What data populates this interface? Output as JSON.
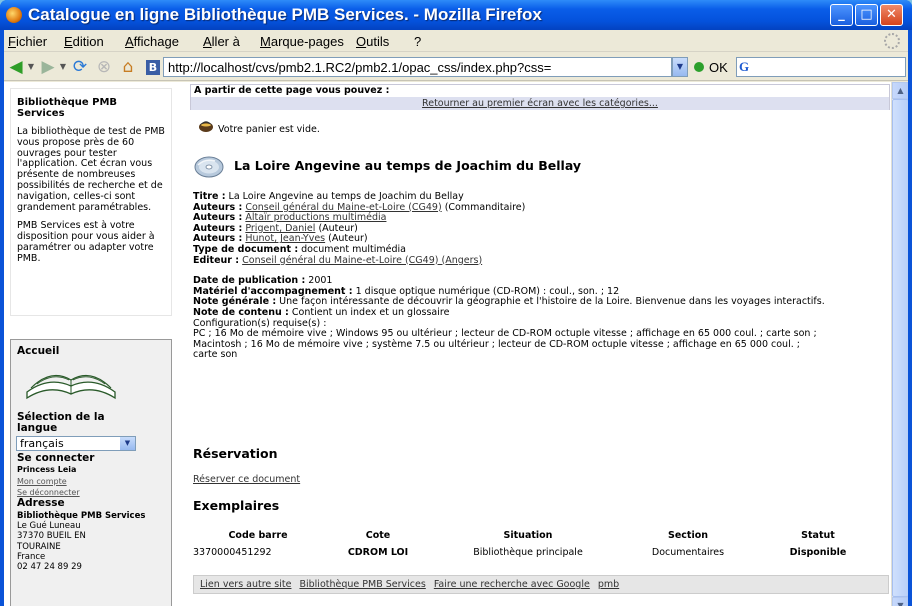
{
  "window": {
    "title": "Catalogue en ligne Bibliothèque PMB Services. - Mozilla Firefox"
  },
  "menu": {
    "items": [
      "Fichier",
      "Edition",
      "Affichage",
      "Aller à",
      "Marque-pages",
      "Outils",
      "?"
    ]
  },
  "navbar": {
    "url": "http://localhost/cvs/pmb2.1.RC2/pmb2.1/opac_css/index.php?css=",
    "go_label": "OK"
  },
  "sidebar": {
    "title": "Bibliothèque PMB Services",
    "para1": "La bibliothèque de test de PMB vous propose près de 60 ouvrages pour tester l'application. Cet écran vous présente de nombreuses possibilités de recherche et de navigation, celles-ci sont grandement paramétrables.",
    "para2": "PMB Services est à votre disposition pour vous aider à paramétrer ou adapter votre PMB.",
    "accueil": "Accueil",
    "lang_title": "Sélection de la langue",
    "lang_value": "français",
    "connect_title": "Se connecter",
    "user": "Princess Leia",
    "mon_compte": "Mon compte",
    "deconnect": "Se déconnecter",
    "adresse_title": "Adresse",
    "address": [
      "Bibliothèque PMB Services",
      "Le Gué Luneau",
      "37370 BUEIL EN",
      "TOURAINE",
      "France",
      "02 47 24 89 29"
    ]
  },
  "main": {
    "top_label": "A partir de cette page vous pouvez :",
    "top_link": "Retourner au premier écran avec les catégories...",
    "basket": "Votre panier est vide.",
    "record_title": "La Loire Angevine au temps de Joachim du Bellay",
    "titre_label": "Titre :",
    "titre_value": "La Loire Angevine au temps de Joachim du Bellay",
    "authors": [
      {
        "label": "Auteurs :",
        "name": "Conseil général du Maine-et-Loire (CG49)",
        "role": "(Commanditaire)"
      },
      {
        "label": "Auteurs :",
        "name": "Altaïr productions multimédia",
        "role": ""
      },
      {
        "label": "Auteurs :",
        "name": "Prigent, Daniel",
        "role": "(Auteur)"
      },
      {
        "label": "Auteurs :",
        "name": "Hunot, Jean-Yves",
        "role": "(Auteur)"
      }
    ],
    "type_label": "Type de document :",
    "type_value": "document multimédia",
    "editeur_label": "Editeur :",
    "editeur_value": "Conseil général du Maine-et-Loire (CG49) (Angers)",
    "date_label": "Date de publication :",
    "date_value": "2001",
    "materiel_label": "Matériel d'accompagnement :",
    "materiel_value": "1 disque optique numérique (CD-ROM) : coul., son. ; 12",
    "note_gen_label": "Note générale :",
    "note_gen_value": "Une façon intéressante de découvrir la géographie et l'histoire de la Loire. Bienvenue dans les voyages interactifs.",
    "note_cont_label": "Note de contenu :",
    "note_cont_value": "Contient un index et un glossaire",
    "config_line1": "Configuration(s) requise(s) :",
    "config_line2": "PC ; 16 Mo de mémoire vive ; Windows 95 ou ultérieur ; lecteur de CD-ROM octuple vitesse ; affichage en 65 000 coul. ; carte son ;",
    "config_line3": "Macintosh ; 16 Mo de mémoire vive ; système 7.5 ou ultérieur ; lecteur de CD-ROM octuple vitesse ; affichage en 65 000 coul. ;",
    "config_line4": "carte son",
    "reservation_title": "Réservation",
    "reserve_link": "Réserver ce document",
    "exemplaires_title": "Exemplaires",
    "table_headers": [
      "Code barre",
      "Cote",
      "Situation",
      "Section",
      "Statut"
    ],
    "table_rows": [
      [
        "3370000451292",
        "CDROM LOI",
        "Bibliothèque principale",
        "Documentaires",
        "Disponible"
      ]
    ],
    "footer_links": [
      "Lien vers autre site",
      "Bibliothèque PMB Services",
      "Faire une recherche avec Google",
      "pmb"
    ]
  }
}
